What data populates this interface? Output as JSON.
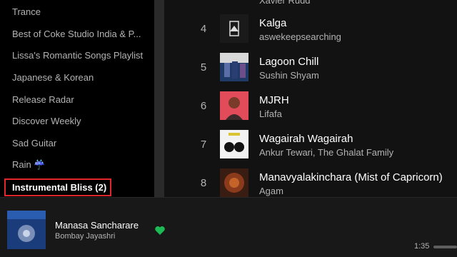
{
  "sidebar": {
    "playlists": [
      {
        "label": "Trance"
      },
      {
        "label": "Best of Coke Studio India & P..."
      },
      {
        "label": "Lissa's Romantic Songs Playlist"
      },
      {
        "label": "Japanese & Korean"
      },
      {
        "label": "Release Radar"
      },
      {
        "label": "Discover Weekly"
      },
      {
        "label": "Sad Guitar"
      },
      {
        "label": "Rain ☔"
      },
      {
        "label": "Instrumental Bliss (2)"
      }
    ]
  },
  "tracklist": {
    "partial_top_artist": "Xavier Rudd",
    "rows": [
      {
        "number": "4",
        "title": "Kalga",
        "artist": "aswekeepsearching",
        "cover_icon": "kalga-cover"
      },
      {
        "number": "5",
        "title": "Lagoon Chill",
        "artist": "Sushin Shyam",
        "cover_icon": "lagoon-chill-cover"
      },
      {
        "number": "6",
        "title": "MJRH",
        "artist": "Lifafa",
        "cover_icon": "mjrh-cover"
      },
      {
        "number": "7",
        "title": "Wagairah Wagairah",
        "artist": "Ankur Tewari, The Ghalat Family",
        "cover_icon": "wagairah-cover"
      },
      {
        "number": "8",
        "title": "Manavyalakinchara (Mist of Capricorn)",
        "artist": "Agam",
        "cover_icon": "manavyalakinchara-cover"
      }
    ]
  },
  "player": {
    "title": "Manasa Sancharare",
    "artist": "Bombay Jayashri",
    "elapsed": "1:35",
    "liked": true
  },
  "colors": {
    "accent": "#1db954",
    "highlight_border": "#e0262b"
  }
}
